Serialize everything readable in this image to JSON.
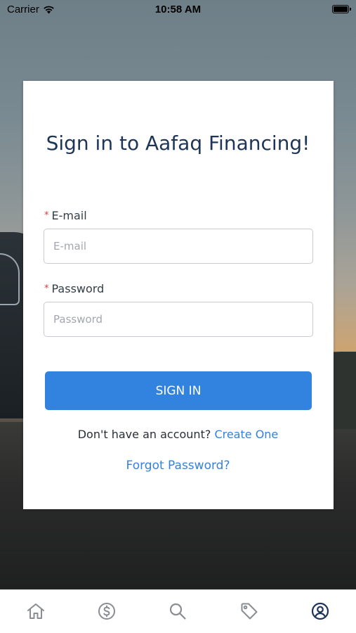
{
  "status_bar": {
    "carrier": "Carrier",
    "time": "10:58 AM"
  },
  "login": {
    "title": "Sign in to Aafaq Financing!",
    "required_mark": "*",
    "email_label": "E-mail",
    "email_placeholder": "E-mail",
    "email_value": "",
    "password_label": "Password",
    "password_placeholder": "Password",
    "password_value": "",
    "signin_label": "SIGN IN",
    "signup_prompt": "Don't have an account?",
    "signup_link": "Create One",
    "forgot_link": "Forgot Password?"
  },
  "tab_bar": {
    "tabs": [
      {
        "icon": "home-icon",
        "active": false
      },
      {
        "icon": "dollar-icon",
        "active": false
      },
      {
        "icon": "search-icon",
        "active": false
      },
      {
        "icon": "tag-icon",
        "active": false
      },
      {
        "icon": "profile-icon",
        "active": true
      }
    ]
  },
  "colors": {
    "accent": "#3282df",
    "title": "#1d3557",
    "required": "#e53935",
    "tab_inactive": "#8a8d91",
    "tab_active": "#1d3557"
  }
}
